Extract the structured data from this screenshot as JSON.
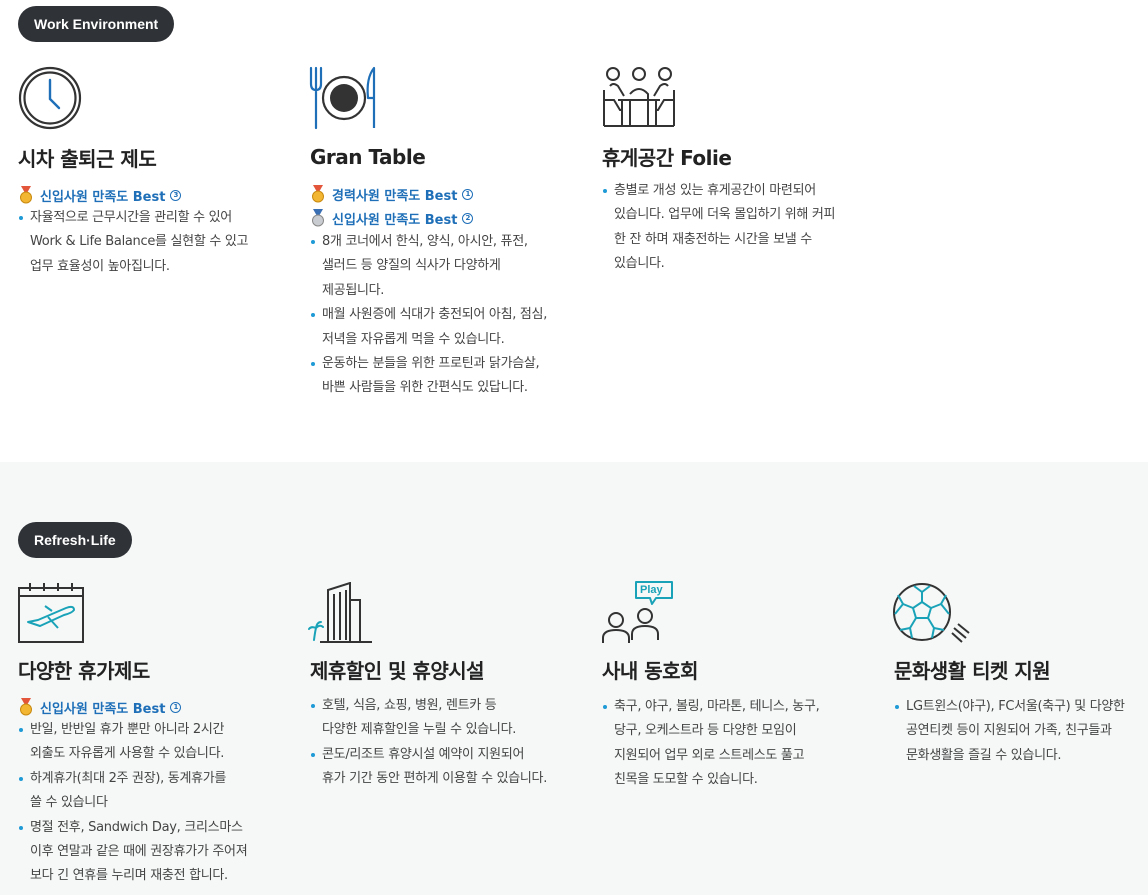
{
  "work": {
    "pill": "Work Environment",
    "items": [
      {
        "icon": "clock-icon",
        "title": "시차 출퇴근 제도",
        "badges": [
          {
            "text": "신입사원 만족도 Best",
            "rank": "3",
            "medal": "gold"
          }
        ],
        "bullets": [
          "자율적으로 근무시간을 관리할 수 있어\nWork & Life Balance를 실현할 수 있고\n업무 효율성이 높아집니다."
        ]
      },
      {
        "icon": "dining-plate-icon",
        "title": "Gran Table",
        "badges": [
          {
            "text": "경력사원 만족도 Best",
            "rank": "1",
            "medal": "gold"
          },
          {
            "text": "신입사원 만족도 Best",
            "rank": "2",
            "medal": "silver"
          }
        ],
        "bullets": [
          "8개 코너에서 한식, 양식, 아시안, 퓨전,\n샐러드 등 양질의 식사가 다양하게\n제공됩니다.",
          "매월 사원증에 식대가 충전되어 아침, 점심,\n저녁을 자유롭게 먹을 수 있습니다.",
          "운동하는 분들을 위한 프로틴과 닭가슴살,\n바쁜 사람들을 위한 간편식도 있답니다."
        ]
      },
      {
        "icon": "lounge-people-icon",
        "title": "휴게공간 Folie",
        "badges": [],
        "bullets": [
          "층별로 개성 있는 휴게공간이 마련되어\n있습니다. 업무에 더욱 몰입하기 위해 커피\n한 잔 하며 재충전하는 시간을 보낼 수\n있습니다."
        ]
      }
    ]
  },
  "refresh": {
    "pill": "Refresh·Life",
    "items": [
      {
        "icon": "calendar-airplane-icon",
        "title": "다양한 휴가제도",
        "badges": [
          {
            "text": "신입사원 만족도 Best",
            "rank": "1",
            "medal": "gold"
          }
        ],
        "bullets": [
          "반일, 반반일 휴가 뿐만 아니라 2시간\n외출도 자유롭게 사용할 수 있습니다.",
          "하계휴가(최대 2주 권장), 동계휴가를\n쓸 수 있습니다",
          "명절 전후, Sandwich Day, 크리스마스\n이후 연말과 같은 때에 권장휴가가 주어져\n보다 긴 연휴를 누리며 재충전 합니다."
        ]
      },
      {
        "icon": "hotel-building-icon",
        "title": "제휴할인 및 휴양시설",
        "badges": [],
        "bullets": [
          "호텔, 식음, 쇼핑, 병원, 렌트카 등\n다양한 제휴할인을 누릴 수 있습니다.",
          "콘도/리조트 휴양시설 예약이 지원되어\n휴가 기간 동안 편하게 이용할 수 있습니다."
        ]
      },
      {
        "icon": "club-play-icon",
        "title": "사내 동호회",
        "play_label": "Play",
        "badges": [],
        "bullets": [
          "축구, 야구, 볼링, 마라톤, 테니스, 농구,\n당구, 오케스트라 등 다양한 모임이\n지원되어 업무 외로 스트레스도 풀고\n친목을 도모할 수 있습니다."
        ]
      },
      {
        "icon": "soccer-ball-icon",
        "title": "문화생활 티켓 지원",
        "badges": [],
        "bullets": [
          "LG트윈스(야구), FC서울(축구) 및 다양한\n공연티켓 등이 지원되어 가족, 친구들과\n문화생활을 즐길 수 있습니다."
        ]
      }
    ]
  },
  "colors": {
    "accent_blue": "#1e6fb8",
    "bullet_blue": "#1e9ad6",
    "icon_teal": "#1aa3b8",
    "pill_bg": "#2f3237"
  }
}
